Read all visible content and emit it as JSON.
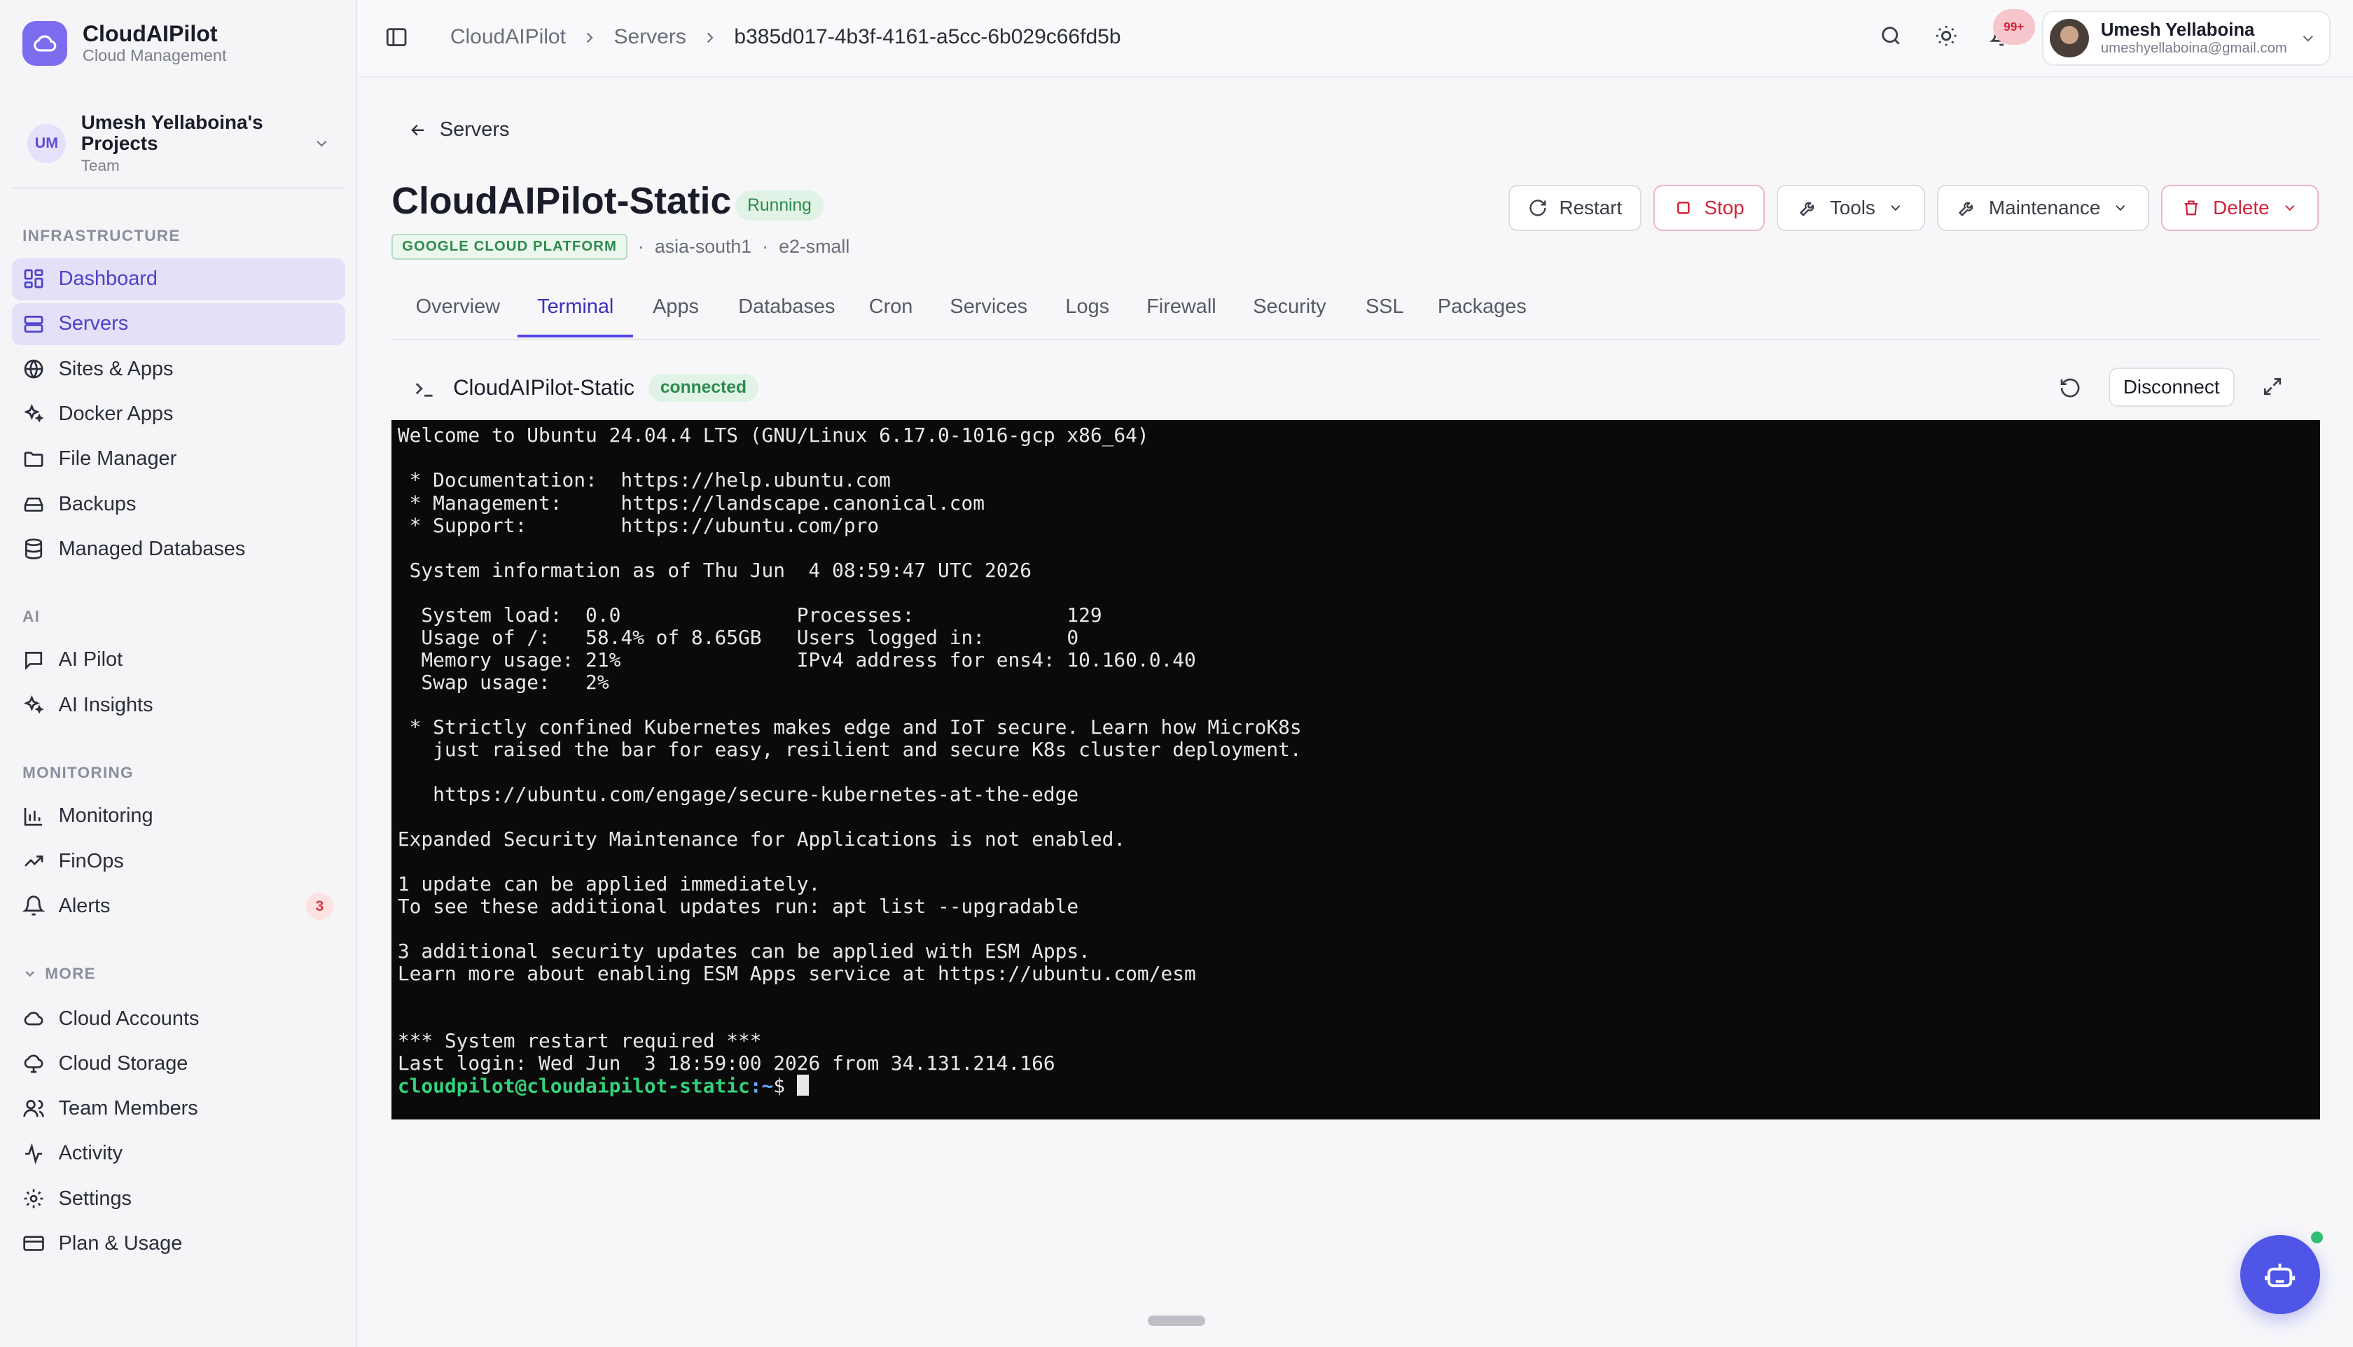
{
  "brand": {
    "title": "CloudAIPilot",
    "subtitle": "Cloud Management"
  },
  "project": {
    "initials": "UM",
    "name": "Umesh Yellaboina's Projects",
    "type": "Team"
  },
  "sidebar": {
    "sections": {
      "infrastructure": "INFRASTRUCTURE",
      "ai": "AI",
      "monitoring": "MONITORING",
      "more": "MORE"
    },
    "infrastructure": [
      "Dashboard",
      "Servers",
      "Sites & Apps",
      "Docker Apps",
      "File Manager",
      "Backups",
      "Managed Databases"
    ],
    "ai": [
      "AI Pilot",
      "AI Insights"
    ],
    "monitoring": [
      "Monitoring",
      "FinOps",
      "Alerts"
    ],
    "alerts_count": "3",
    "more": [
      "Cloud Accounts",
      "Cloud Storage",
      "Team Members",
      "Activity",
      "Settings",
      "Plan & Usage"
    ]
  },
  "breadcrumb": [
    "CloudAIPilot",
    "Servers",
    "b385d017-4b3f-4161-a5cc-6b029c66fd5b"
  ],
  "header": {
    "notifications": "99+",
    "user_name": "Umesh Yellaboina",
    "user_email": "umeshyellaboina@gmail.com"
  },
  "server": {
    "back_label": "Servers",
    "name": "CloudAIPilot-Static",
    "status": "Running",
    "provider": "GOOGLE CLOUD PLATFORM",
    "region": "asia-south1",
    "size": "e2-small"
  },
  "actions": {
    "restart": "Restart",
    "stop": "Stop",
    "tools": "Tools",
    "maintenance": "Maintenance",
    "delete": "Delete"
  },
  "tabs": [
    "Overview",
    "Terminal",
    "Apps",
    "Databases",
    "Cron",
    "Services",
    "Logs",
    "Firewall",
    "Security",
    "SSL",
    "Packages"
  ],
  "active_tab": "Terminal",
  "terminal": {
    "title": "CloudAIPilot-Static",
    "status": "connected",
    "disconnect_label": "Disconnect",
    "output": "Welcome to Ubuntu 24.04.4 LTS (GNU/Linux 6.17.0-1016-gcp x86_64)\n\n * Documentation:  https://help.ubuntu.com\n * Management:     https://landscape.canonical.com\n * Support:        https://ubuntu.com/pro\n\n System information as of Thu Jun  4 08:59:47 UTC 2026\n\n  System load:  0.0               Processes:             129\n  Usage of /:   58.4% of 8.65GB   Users logged in:       0\n  Memory usage: 21%               IPv4 address for ens4: 10.160.0.40\n  Swap usage:   2%\n\n * Strictly confined Kubernetes makes edge and IoT secure. Learn how MicroK8s\n   just raised the bar for easy, resilient and secure K8s cluster deployment.\n\n   https://ubuntu.com/engage/secure-kubernetes-at-the-edge\n\nExpanded Security Maintenance for Applications is not enabled.\n\n1 update can be applied immediately.\nTo see these additional updates run: apt list --upgradable\n\n3 additional security updates can be applied with ESM Apps.\nLearn more about enabling ESM Apps service at https://ubuntu.com/esm\n\n\n*** System restart required ***\nLast login: Wed Jun  3 18:59:00 2026 from 34.131.214.166",
    "prompt_user": "cloudpilot@cloudaipilot-static",
    "prompt_path": ":~",
    "prompt_symbol": "$ "
  },
  "colors": {
    "accent": "#4f46e5",
    "brand": "#7c6cf0",
    "success": "#2f8a4c",
    "danger": "#d0243c"
  }
}
